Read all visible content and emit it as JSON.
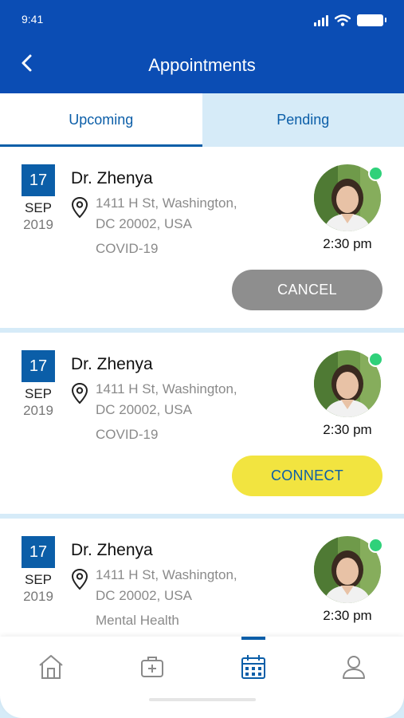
{
  "status_bar": {
    "time": "9:41"
  },
  "header": {
    "title": "Appointments"
  },
  "tabs": [
    {
      "label": "Upcoming",
      "active": true
    },
    {
      "label": "Pending",
      "active": false
    }
  ],
  "appointments": [
    {
      "day": "17",
      "month": "SEP",
      "year": "2019",
      "doctor": "Dr. Zhenya",
      "address_line1": "1411 H St, Washington,",
      "address_line2": "DC 20002, USA",
      "reason": "COVID-19",
      "time": "2:30 pm",
      "action": "CANCEL",
      "online": true
    },
    {
      "day": "17",
      "month": "SEP",
      "year": "2019",
      "doctor": "Dr. Zhenya",
      "address_line1": "1411 H St, Washington,",
      "address_line2": "DC 20002, USA",
      "reason": "COVID-19",
      "time": "2:30 pm",
      "action": "CONNECT",
      "online": true
    },
    {
      "day": "17",
      "month": "SEP",
      "year": "2019",
      "doctor": "Dr. Zhenya",
      "address_line1": "1411 H St, Washington,",
      "address_line2": "DC 20002, USA",
      "reason": "Mental Health",
      "time": "2:30 pm",
      "online": true
    }
  ],
  "bottom_nav": [
    {
      "icon": "home-icon",
      "active": false
    },
    {
      "icon": "medical-kit-icon",
      "active": false
    },
    {
      "icon": "calendar-icon",
      "active": true
    },
    {
      "icon": "profile-icon",
      "active": false
    }
  ],
  "colors": {
    "header": "#0b4db4",
    "accent": "#0b5ea8",
    "connect": "#f2e440",
    "cancel": "#8e8e8e",
    "online": "#2fd17a"
  }
}
